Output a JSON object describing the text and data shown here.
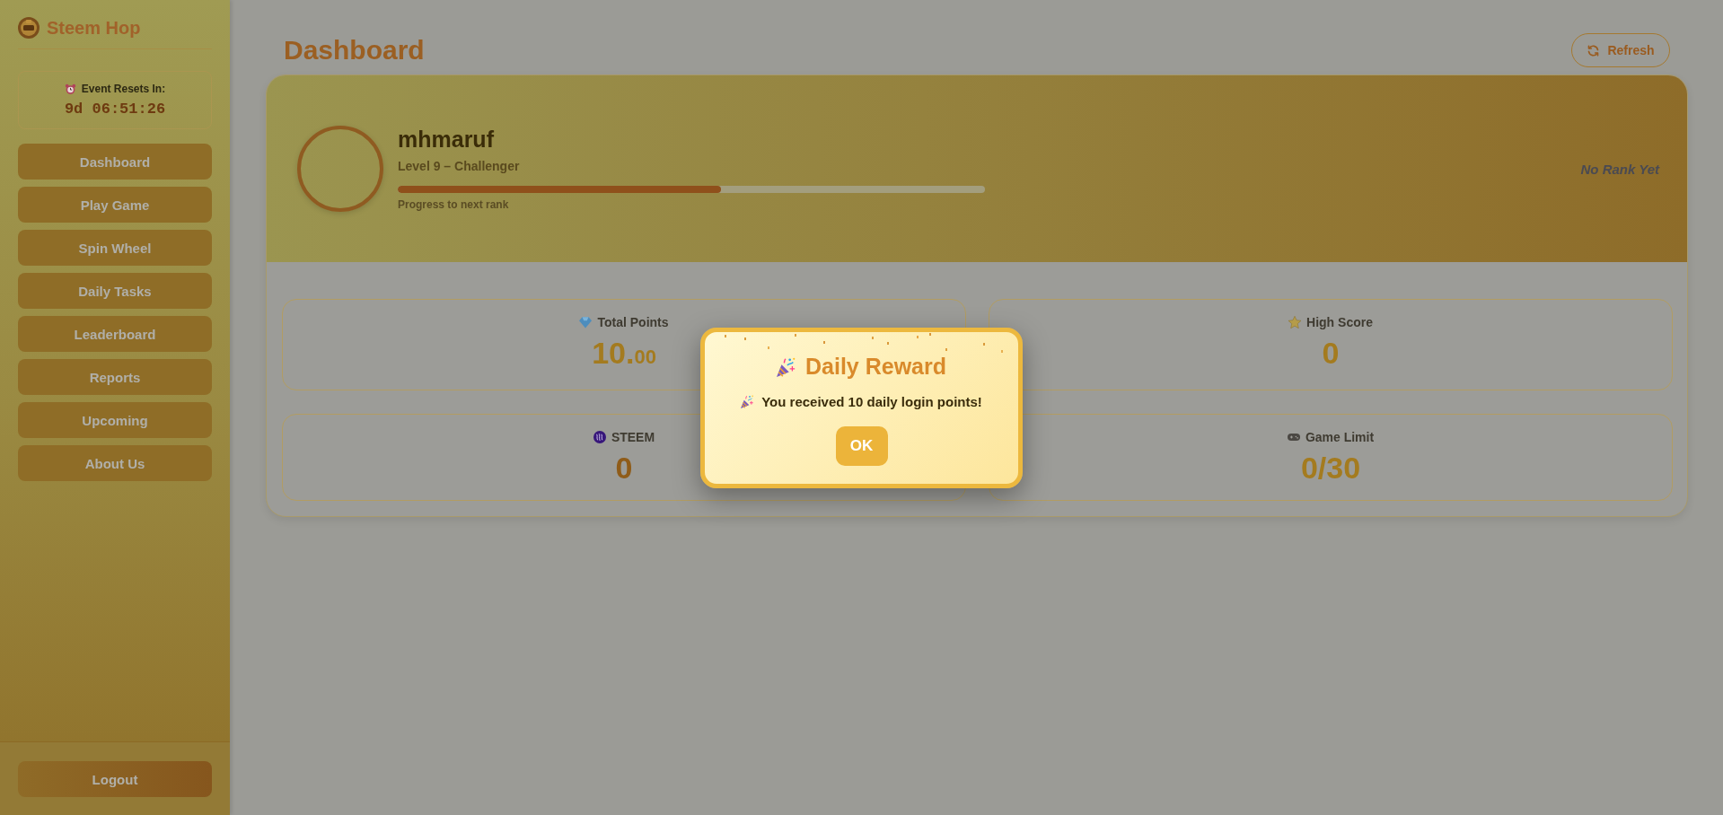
{
  "sidebar": {
    "brand": "Steem Hop",
    "timer": {
      "label": "Event Resets In:",
      "value": "9d 06:51:26"
    },
    "nav": [
      {
        "label": "Dashboard"
      },
      {
        "label": "Play Game"
      },
      {
        "label": "Spin Wheel"
      },
      {
        "label": "Daily Tasks"
      },
      {
        "label": "Leaderboard"
      },
      {
        "label": "Reports"
      },
      {
        "label": "Upcoming"
      },
      {
        "label": "About Us"
      }
    ],
    "logout": "Logout"
  },
  "header": {
    "title": "Dashboard",
    "refresh": "Refresh"
  },
  "profile": {
    "username": "mhmaruf",
    "level_text": "Level 9 – Challenger",
    "progress": {
      "level": 0.55,
      "caption": "Progress to next rank"
    },
    "rank": "No Rank Yet"
  },
  "stats": [
    {
      "kind": "points",
      "label": "Total Points",
      "value": "10.",
      "fraction": "00"
    },
    {
      "kind": "score",
      "label": "High Score",
      "value": "0"
    },
    {
      "kind": "token",
      "label": "STEEM",
      "value": "0"
    },
    {
      "kind": "limit",
      "label": "Game Limit",
      "value": "0/30"
    }
  ],
  "dialog": {
    "title": "Daily Reward",
    "message": "You received 10 daily login points!",
    "button": "OK"
  }
}
